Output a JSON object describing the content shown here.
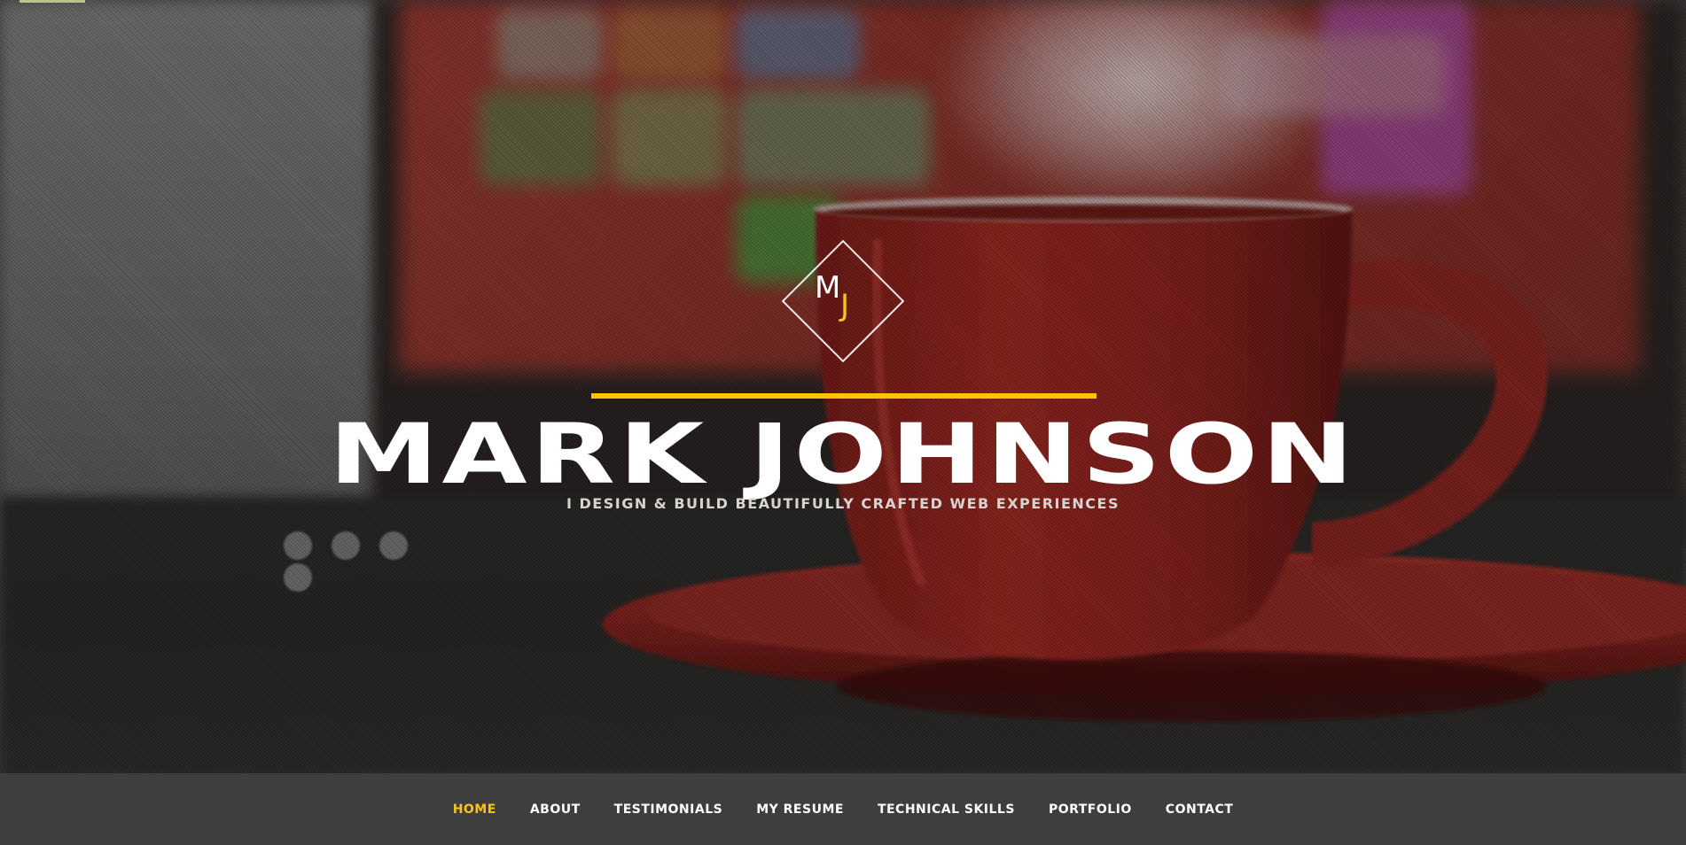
{
  "hero": {
    "logo": {
      "letter_m": "M",
      "letter_j": "J"
    },
    "name": "MARK JOHNSON",
    "tagline": "I DESIGN & BUILD BEAUTIFULLY CRAFTED WEB EXPERIENCES",
    "accent_color": "#ffc400"
  },
  "nav": {
    "items": [
      {
        "label": "HOME",
        "active": true
      },
      {
        "label": "ABOUT",
        "active": false
      },
      {
        "label": "TESTIMONIALS",
        "active": false
      },
      {
        "label": "MY RESUME",
        "active": false
      },
      {
        "label": "TECHNICAL SKILLS",
        "active": false
      },
      {
        "label": "PORTFOLIO",
        "active": false
      },
      {
        "label": "CONTACT",
        "active": false
      }
    ],
    "active_color": "#f5c518",
    "text_color": "#ffffff",
    "background": "#3e3e3e"
  }
}
